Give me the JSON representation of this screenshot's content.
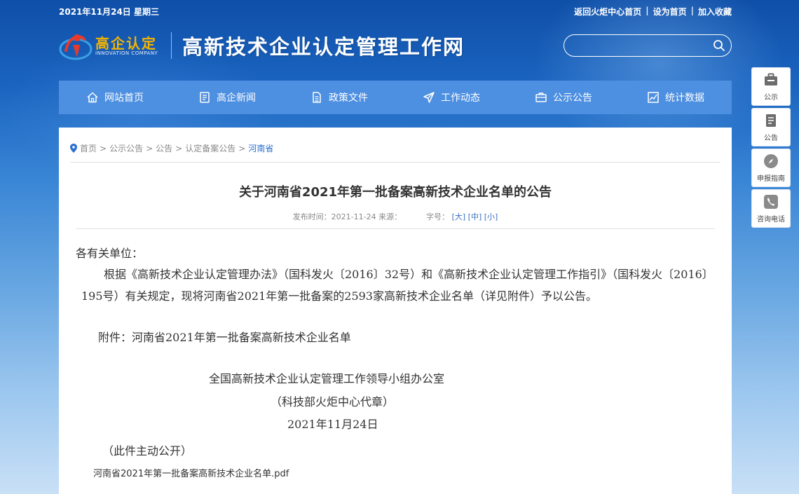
{
  "topbar": {
    "date": "2021年11月24日 星期三",
    "links": [
      "返回火炬中心首页",
      "设为首页",
      "加入收藏"
    ],
    "separator": "|"
  },
  "logo": {
    "mark_text": "高企认定",
    "mark_en": "INNOVATION COMPANY",
    "site_title": "高新技术企业认定管理工作网"
  },
  "search": {
    "placeholder": "",
    "icon": "search-icon"
  },
  "nav": [
    {
      "label": "网站首页",
      "icon": "home-icon"
    },
    {
      "label": "高企新闻",
      "icon": "news-icon"
    },
    {
      "label": "政策文件",
      "icon": "document-icon"
    },
    {
      "label": "工作动态",
      "icon": "paper-plane-icon"
    },
    {
      "label": "公示公告",
      "icon": "briefcase-icon"
    },
    {
      "label": "统计数据",
      "icon": "chart-icon"
    }
  ],
  "breadcrumb": {
    "items": [
      "首页",
      "公示公告",
      "公告",
      "认定备案公告"
    ],
    "current": "河南省",
    "separator": ">"
  },
  "article": {
    "title": "关于河南省2021年第一批备案高新技术企业名单的公告",
    "meta_prefix": "发布时间：2021-11-24 来源：",
    "font_size_label": "字号：",
    "font_sizes": [
      "[大]",
      "[中]",
      "[小]"
    ],
    "greeting": "各有关单位：",
    "main_paragraph": "根据《高新技术企业认定管理办法》（国科发火〔2016〕32号）和《高新技术企业认定管理工作指引》（国科发火〔2016〕195号）有关规定，现将河南省2021年第一批备案的2593家高新技术企业名单（详见附件）予以公告。",
    "attachment_line": "附件：河南省2021年第一批备案高新技术企业名单",
    "issuer": "全国高新技术企业认定管理工作领导小组办公室",
    "issuer_note": "（科技部火炬中心代章）",
    "sign_date": "2021年11月24日",
    "open_note": "（此件主动公开）",
    "file_link": "河南省2021年第一批备案高新技术企业名单.pdf"
  },
  "side": [
    {
      "label": "公示",
      "icon": "briefcase-icon"
    },
    {
      "label": "公告",
      "icon": "clipboard-icon"
    },
    {
      "label": "申报指南",
      "icon": "compass-icon"
    },
    {
      "label": "咨询电话",
      "icon": "phone-icon"
    }
  ]
}
